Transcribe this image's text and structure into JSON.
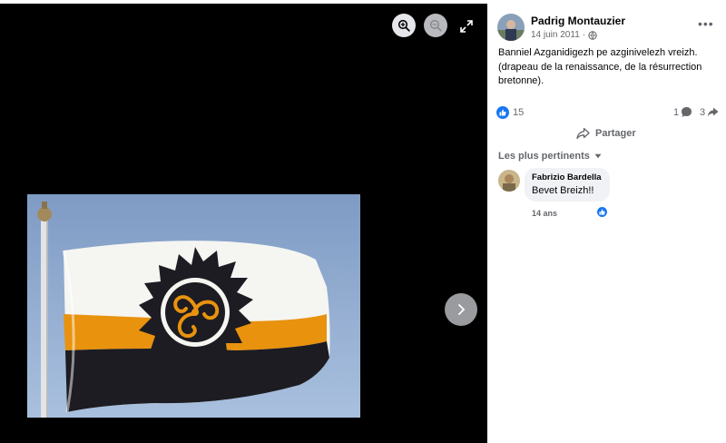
{
  "post": {
    "author": "Padrig Montauzier",
    "date": "14 juin 2011",
    "date_separator": "·",
    "more_label": "•••",
    "text_lines": [
      "Banniel Azganidigezh pe azginivelezh vreizh.",
      "(drapeau de la renaissance, de la résurrection",
      "bretonne)."
    ]
  },
  "stats": {
    "reactions": "15",
    "comments": "1",
    "shares": "3"
  },
  "actions": {
    "share_label": "Partager"
  },
  "comments_section": {
    "sort_label": "Les plus pertinents",
    "comments": [
      {
        "author": "Fabrizio Bardella",
        "text": "Bevet Breizh!!",
        "time": "14 ans"
      }
    ]
  },
  "colors": {
    "brand_blue": "#1877f2",
    "viewer_bg": "#000000",
    "secondary_text": "#65676b",
    "comment_bubble": "#f0f2f5"
  },
  "icons": [
    "zoom-in-icon",
    "zoom-out-icon",
    "fullscreen-icon",
    "chevron-right-icon",
    "globe-icon",
    "thumbs-up-icon",
    "comment-icon",
    "share-icon",
    "caret-down-icon"
  ]
}
